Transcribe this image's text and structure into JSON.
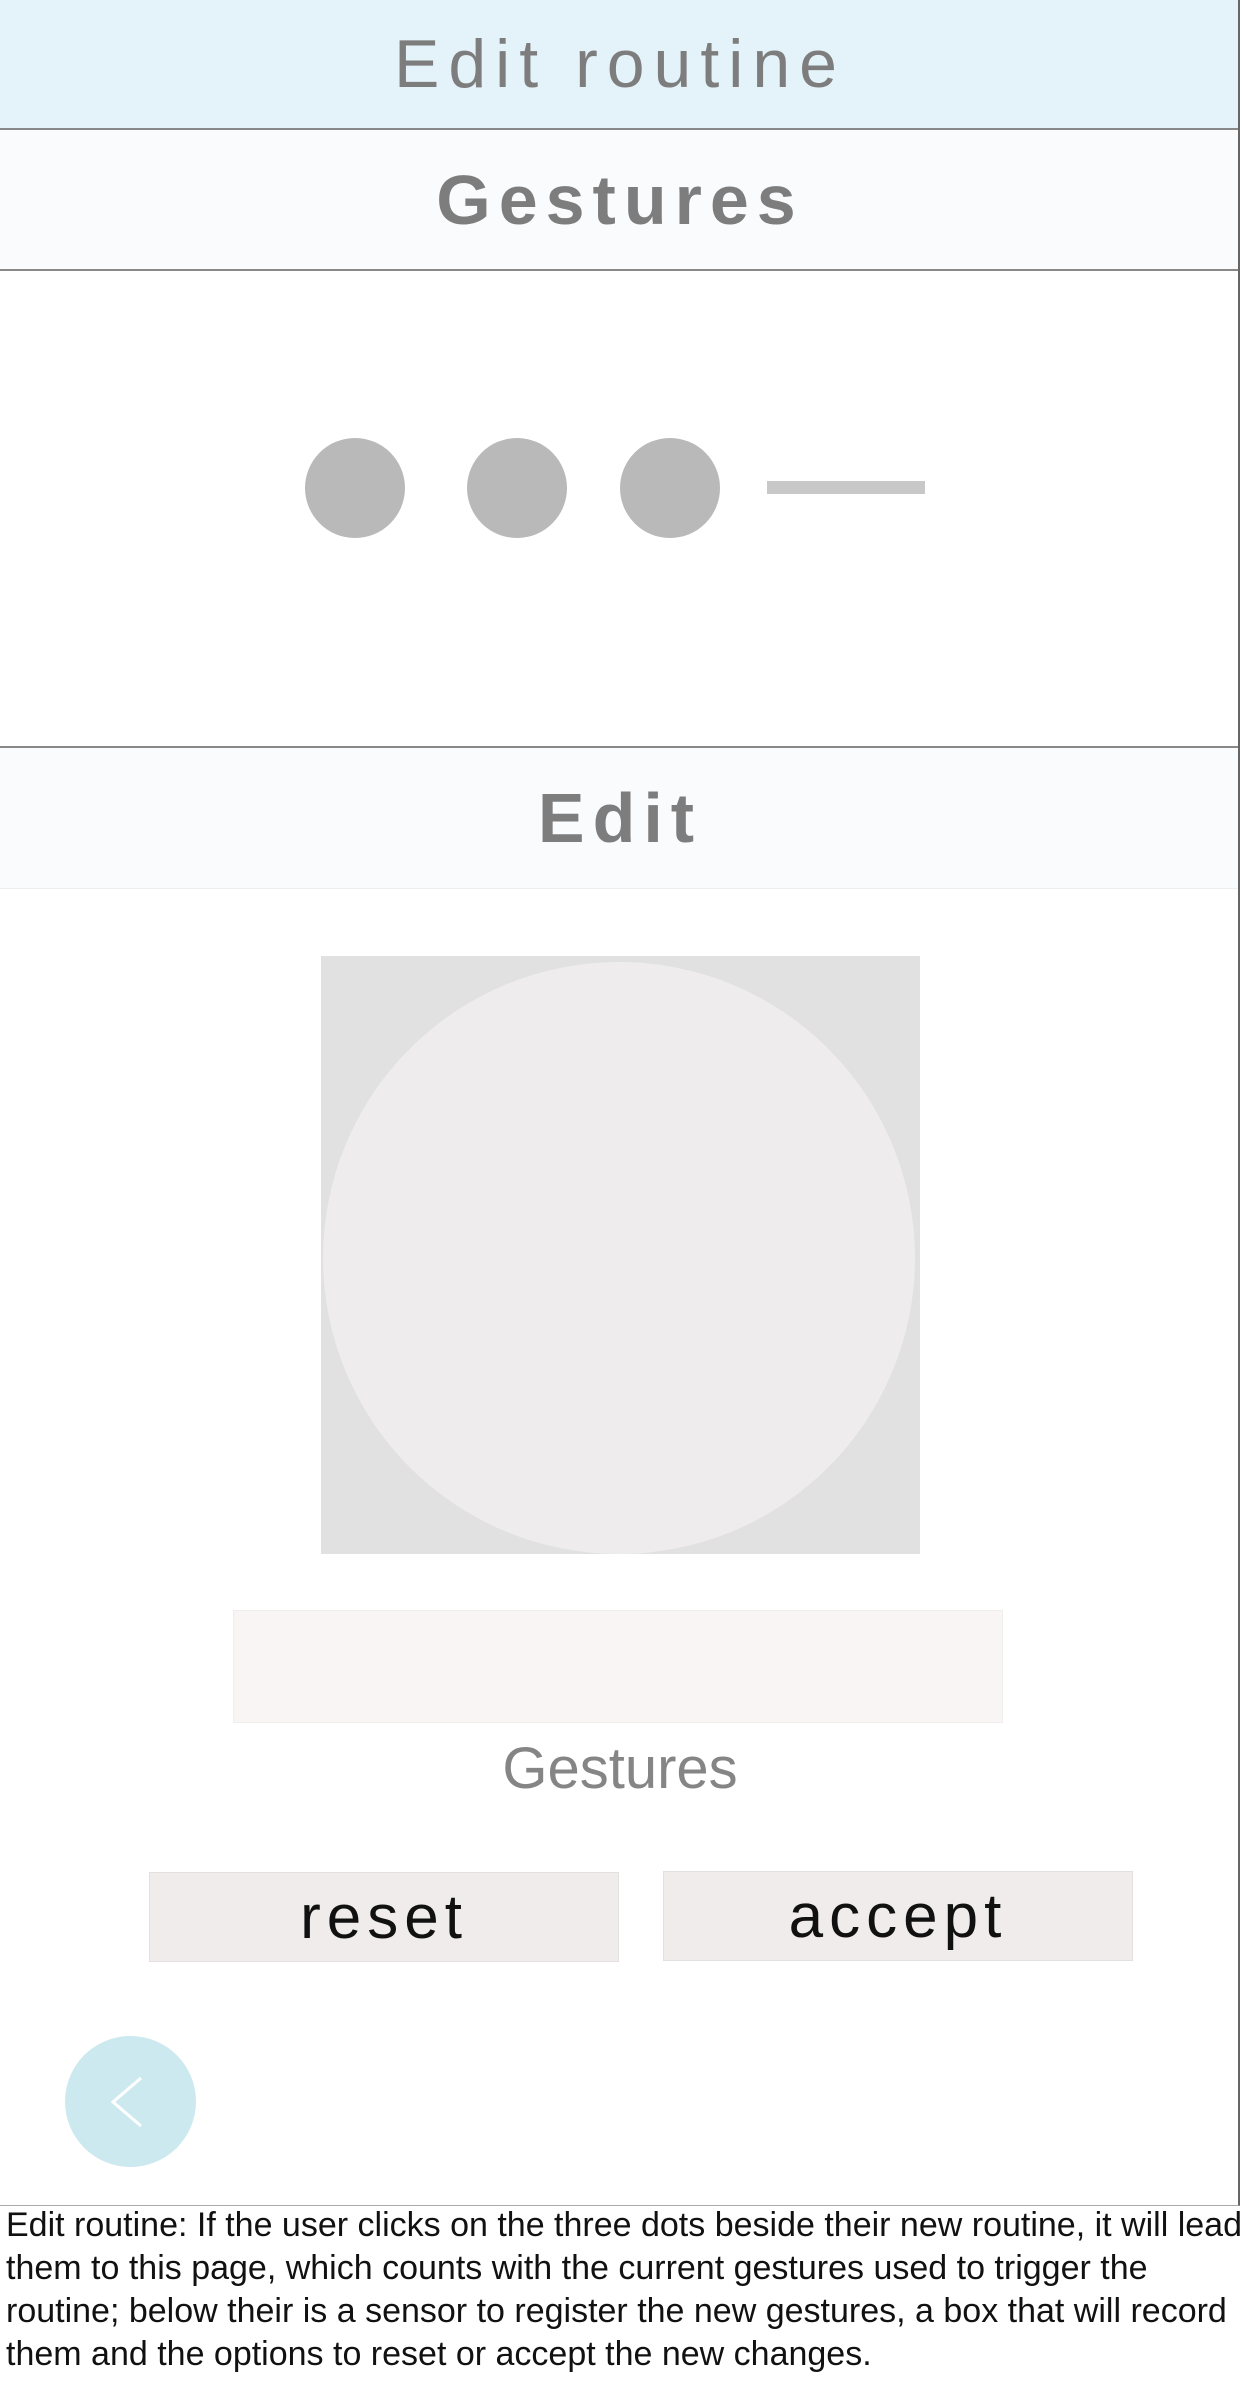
{
  "header": {
    "title": "Edit routine"
  },
  "gestures_section": {
    "title": "Gestures",
    "sequence": [
      {
        "type": "dot",
        "icon": "dot-icon"
      },
      {
        "type": "dot",
        "icon": "dot-icon"
      },
      {
        "type": "dot",
        "icon": "dot-icon"
      },
      {
        "type": "dash",
        "icon": "dash-icon"
      }
    ]
  },
  "edit_section": {
    "title": "Edit",
    "record_label": "Gestures",
    "reset_label": "reset",
    "accept_label": "accept"
  },
  "back_button": {
    "icon": "chevron-left-icon"
  },
  "caption": "Edit routine: If the user clicks on the three dots beside their new routine, it will lead them to this page, which counts with the current gestures used to trigger the routine; below their is a sensor to register the new gestures, a box that will record them and the options to reset or accept the new changes.",
  "colors": {
    "header_bg": "#e3f3f9",
    "section_bg": "#f9fbfd",
    "dot": "#b8b9b8",
    "button_bg": "#f0ecec",
    "back_button_bg": "#cde9f0"
  }
}
